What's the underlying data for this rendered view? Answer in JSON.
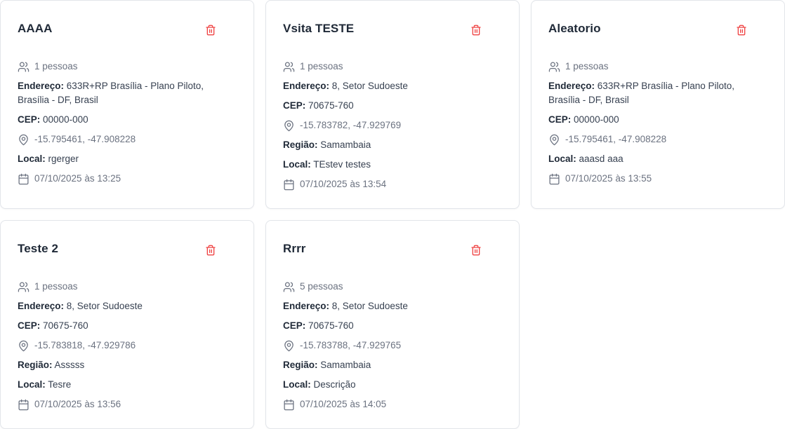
{
  "colors": {
    "danger": "#ef4444",
    "muted": "#6b7280",
    "border": "#e2e5ea"
  },
  "labels": {
    "address": "Endereço:",
    "cep": "CEP:",
    "region": "Região:",
    "local": "Local:"
  },
  "cards": [
    {
      "title": "AAAA",
      "people": "1 pessoas",
      "address": "633R+RP Brasília - Plano Piloto, Brasília - DF, Brasil",
      "cep": "00000-000",
      "coords": "-15.795461, -47.908228",
      "local": "rgerger",
      "datetime": "07/10/2025 às 13:25"
    },
    {
      "title": "Vsita TESTE",
      "people": "1 pessoas",
      "address": "8, Setor Sudoeste",
      "cep": "70675-760",
      "coords": "-15.783782, -47.929769",
      "region": "Samambaia",
      "local": "TEstev testes",
      "datetime": "07/10/2025 às 13:54"
    },
    {
      "title": "Aleatorio",
      "people": "1 pessoas",
      "address": "633R+RP Brasília - Plano Piloto, Brasília - DF, Brasil",
      "cep": "00000-000",
      "coords": "-15.795461, -47.908228",
      "local": "aaasd aaa",
      "datetime": "07/10/2025 às 13:55"
    },
    {
      "title": "Teste 2",
      "people": "1 pessoas",
      "address": "8, Setor Sudoeste",
      "cep": "70675-760",
      "coords": "-15.783818, -47.929786",
      "region": "Asssss",
      "local": "Tesre",
      "datetime": "07/10/2025 às 13:56"
    },
    {
      "title": "Rrrr",
      "people": "5 pessoas",
      "address": "8, Setor Sudoeste",
      "cep": "70675-760",
      "coords": "-15.783788, -47.929765",
      "region": "Samambaia",
      "local": "Descrição",
      "datetime": "07/10/2025 às 14:05"
    }
  ]
}
